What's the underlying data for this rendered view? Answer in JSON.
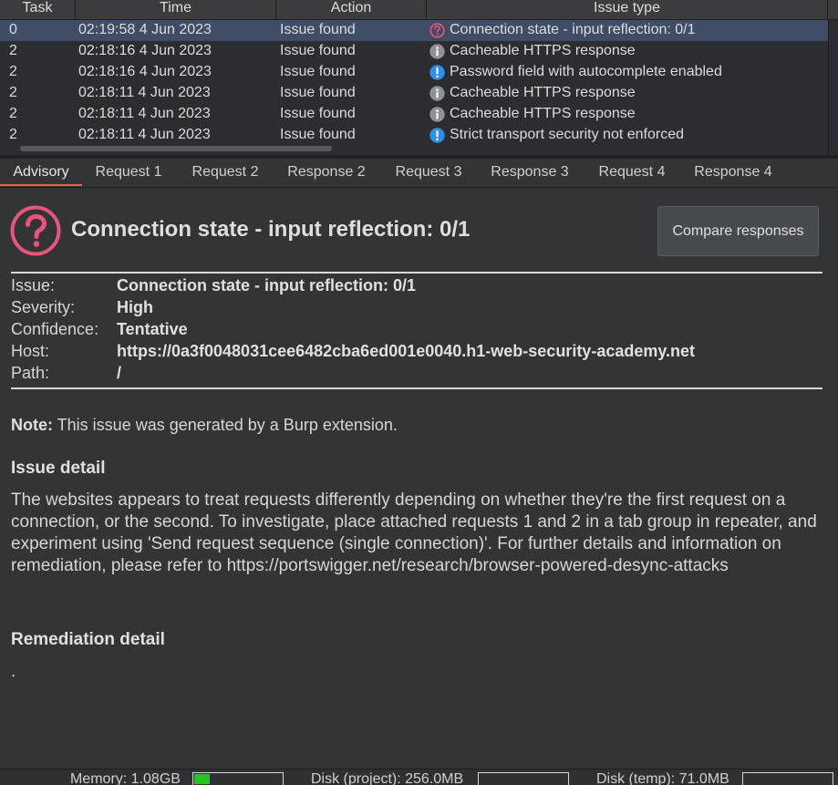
{
  "table": {
    "headers": {
      "task": "Task",
      "time": "Time",
      "action": "Action",
      "issue_type": "Issue type"
    },
    "rows": [
      {
        "task": "0",
        "time": "02:19:58 4 Jun 2023",
        "action": "Issue found",
        "issue": "Connection state - input reflection: 0/1",
        "icon": "question-icon",
        "selected": true
      },
      {
        "task": "2",
        "time": "02:18:16 4 Jun 2023",
        "action": "Issue found",
        "issue": "Cacheable HTTPS response",
        "icon": "info-icon"
      },
      {
        "task": "2",
        "time": "02:18:16 4 Jun 2023",
        "action": "Issue found",
        "issue": "Password field with autocomplete enabled",
        "icon": "exclamation-icon"
      },
      {
        "task": "2",
        "time": "02:18:11 4 Jun 2023",
        "action": "Issue found",
        "issue": "Cacheable HTTPS response",
        "icon": "info-icon"
      },
      {
        "task": "2",
        "time": "02:18:11 4 Jun 2023",
        "action": "Issue found",
        "issue": "Cacheable HTTPS response",
        "icon": "info-icon"
      },
      {
        "task": "2",
        "time": "02:18:11 4 Jun 2023",
        "action": "Issue found",
        "issue": "Strict transport security not enforced",
        "icon": "exclamation-icon"
      }
    ]
  },
  "tabs": [
    "Advisory",
    "Request 1",
    "Request 2",
    "Response 2",
    "Request 3",
    "Response 3",
    "Request 4",
    "Response 4"
  ],
  "advisory": {
    "title": "Connection state - input reflection: 0/1",
    "compare_button": "Compare responses",
    "fields": [
      {
        "label": "Issue:",
        "value": "Connection state - input reflection: 0/1"
      },
      {
        "label": "Severity:",
        "value": "High"
      },
      {
        "label": "Confidence:",
        "value": "Tentative"
      },
      {
        "label": "Host:",
        "value": "https://0a3f0048031cee6482cba6ed001e0040.h1-web-security-academy.net"
      },
      {
        "label": "Path:",
        "value": "/"
      }
    ],
    "note_label": "Note:",
    "note_text": " This issue was generated by a Burp extension.",
    "issue_detail_heading": "Issue detail",
    "issue_detail_text": "The websites appears to treat requests differently depending on whether they're the first request on a connection, or the second. To investigate, place attached requests 1 and 2 in a tab group in repeater, and experiment using 'Send request sequence (single connection)'. For further details and information on remediation, please refer to https://portswigger.net/research/browser-powered-desync-attacks",
    "remediation_heading": "Remediation detail",
    "remediation_text": "."
  },
  "status": {
    "memory": "Memory: 1.08GB",
    "memory_fraction": 0.18,
    "disk_project": "Disk (project): 256.0MB",
    "disk_project_fraction": 0,
    "disk_temp": "Disk (temp): 71.0MB",
    "disk_temp_fraction": 0
  },
  "colors": {
    "selected_row": "#3f4d66",
    "question_icon": "#e8557a",
    "info_icon": "#8e9296",
    "exclamation_icon": "#2f8fe6",
    "tab_accent": "#e8664a",
    "memory_fill": "#25c425"
  }
}
